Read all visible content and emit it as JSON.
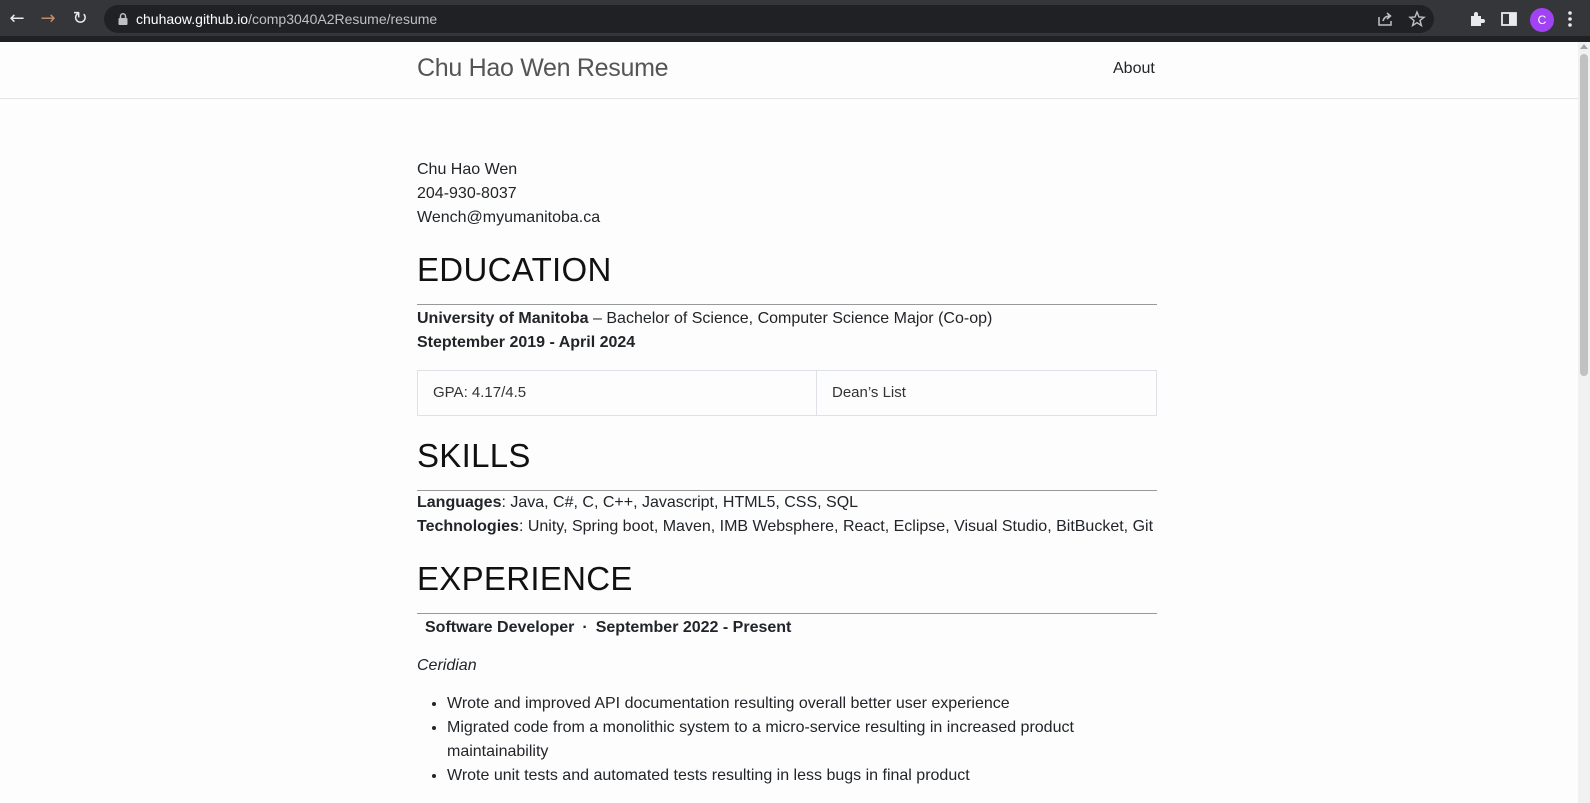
{
  "browser": {
    "url_host": "chuhaow.github.io",
    "url_path": "/comp3040A2Resume/resume",
    "profile_initial": "C",
    "icons": [
      "back-icon",
      "forward-icon",
      "reload-icon",
      "lock-icon",
      "share-icon",
      "star-icon",
      "extensions-icon",
      "side-panel-icon",
      "menu-icon"
    ]
  },
  "navbar": {
    "brand": "Chu Hao Wen Resume",
    "about": "About"
  },
  "contact": {
    "name": "Chu Hao Wen",
    "phone": "204-930-8037",
    "email": "Wench@myumanitoba.ca"
  },
  "education": {
    "heading": "EDUCATION",
    "school": "University of Manitoba",
    "degree": " – Bachelor of Science, Computer Science Major (Co-op)",
    "dates": "Steptember 2019 - April 2024",
    "gpa": "GPA: 4.17/4.5",
    "honor": "Dean’s List"
  },
  "skills": {
    "heading": "SKILLS",
    "languages_label": "Languages",
    "languages": ": Java, C#, C, C++, Javascript, HTML5, CSS, SQL",
    "technologies_label": "Technologies",
    "technologies": ": Unity, Spring boot, Maven, IMB Websphere, React, Eclipse, Visual Studio, BitBucket, Git"
  },
  "experience": {
    "heading": "EXPERIENCE",
    "role": "Software Developer",
    "separator": "·",
    "dates": "September 2022 - Present",
    "company": "Ceridian",
    "bullets": [
      "Wrote and improved API documentation resulting overall better user experience",
      "Migrated code from a monolithic system to a micro-service resulting in increased product maintainability",
      "Wrote unit tests and automated tests resulting in less bugs in final product"
    ]
  }
}
